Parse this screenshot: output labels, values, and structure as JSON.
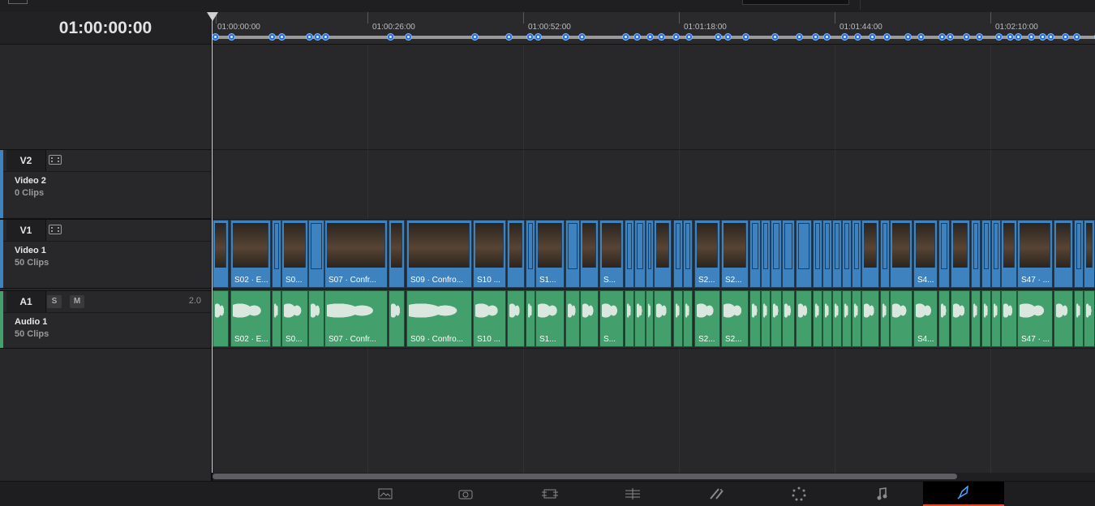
{
  "timeline": {
    "current_timecode": "01:00:00:00",
    "ruler_labels": [
      "01:00:00:00",
      "01:00:26:00",
      "01:00:52:00",
      "01:01:18:00",
      "01:01:44:00",
      "01:02:10:00"
    ]
  },
  "tracks": {
    "v2": {
      "id": "V2",
      "name": "Video 2",
      "clips": "0 Clips"
    },
    "v1": {
      "id": "V1",
      "name": "Video 1",
      "clips": "50 Clips"
    },
    "a1": {
      "id": "A1",
      "name": "Audio 1",
      "clips": "50 Clips",
      "solo": "S",
      "mute": "M",
      "channels": "2.0"
    }
  },
  "clip_labels": {
    "c1": "S02 · E...",
    "c2": "S0...",
    "c3": "S07 · Confr...",
    "c4": "S09 · Confro...",
    "c5": "S10 ...",
    "c6": "S1...",
    "c7": "S...",
    "c8": "S2...",
    "c9": "S2...",
    "c10": "S4...",
    "c11": "S47 · ..."
  },
  "pages": [
    "media-page-icon",
    "cut-page-icon",
    "edit-page-icon",
    "fusion-page-icon",
    "color-page-icon",
    "fairlight-page-icon",
    "music-page-icon",
    "deliver-page-icon"
  ],
  "colors": {
    "video_clip": "#3e82c0",
    "audio_clip": "#43a06c",
    "active_page": "#e0482c"
  }
}
